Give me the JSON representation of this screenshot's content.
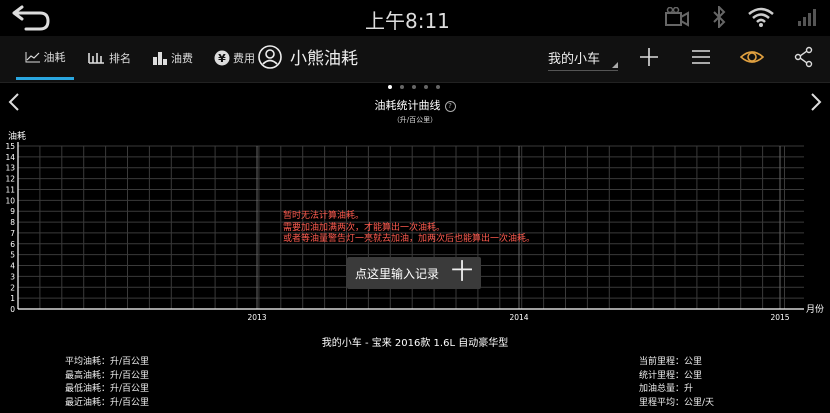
{
  "status": {
    "time": "上午8:11"
  },
  "tabs": [
    {
      "label": "油耗",
      "icon": "line-chart-icon"
    },
    {
      "label": "排名",
      "icon": "ranking-bars-icon"
    },
    {
      "label": "油费",
      "icon": "bar-chart-icon"
    },
    {
      "label": "费用",
      "icon": "yen-icon"
    }
  ],
  "app": {
    "title": "小熊油耗"
  },
  "car_select": {
    "value": "我的小车"
  },
  "pager": {
    "count": 5,
    "active": 0
  },
  "chart_data": {
    "type": "line",
    "title": "油耗统计曲线",
    "subtitle": "（升/百公里）",
    "ylabel": "油耗",
    "xlabel": "月份",
    "ylim": [
      0,
      15
    ],
    "y_ticks": [
      "0",
      "1",
      "2",
      "3",
      "4",
      "5",
      "6",
      "7",
      "8",
      "9",
      "10",
      "11",
      "12",
      "13",
      "14",
      "15"
    ],
    "x_tick_labels": [
      "2013",
      "2014",
      "2015"
    ],
    "grid": true,
    "series": []
  },
  "message": {
    "line1": "暂时无法计算油耗。",
    "line2": "需要加油加满两次，才能算出一次油耗。",
    "line3": "或者等油量警告灯一亮就去加油，加两次后也能算出一次油耗。"
  },
  "entry_button": {
    "label": "点这里输入记录",
    "plus": "十"
  },
  "car_model": "我的小车 - 宝来 2016款 1.6L 自动豪华型",
  "left_stats": [
    {
      "label": "平均油耗：",
      "value": "升/百公里"
    },
    {
      "label": "最高油耗：",
      "value": "升/百公里"
    },
    {
      "label": "最低油耗：",
      "value": "升/百公里"
    },
    {
      "label": "最近油耗：",
      "value": "升/百公里"
    }
  ],
  "right_stats": [
    {
      "label": "当前里程：",
      "value": "公里"
    },
    {
      "label": "统计里程：",
      "value": "公里"
    },
    {
      "label": "加油总量：",
      "value": "升"
    },
    {
      "label": "里程平均：",
      "value": "公里/天"
    }
  ],
  "colors": {
    "accent": "#2aa7e0",
    "warning_text": "#ff5b4f",
    "eye_icon": "#e0a040"
  }
}
